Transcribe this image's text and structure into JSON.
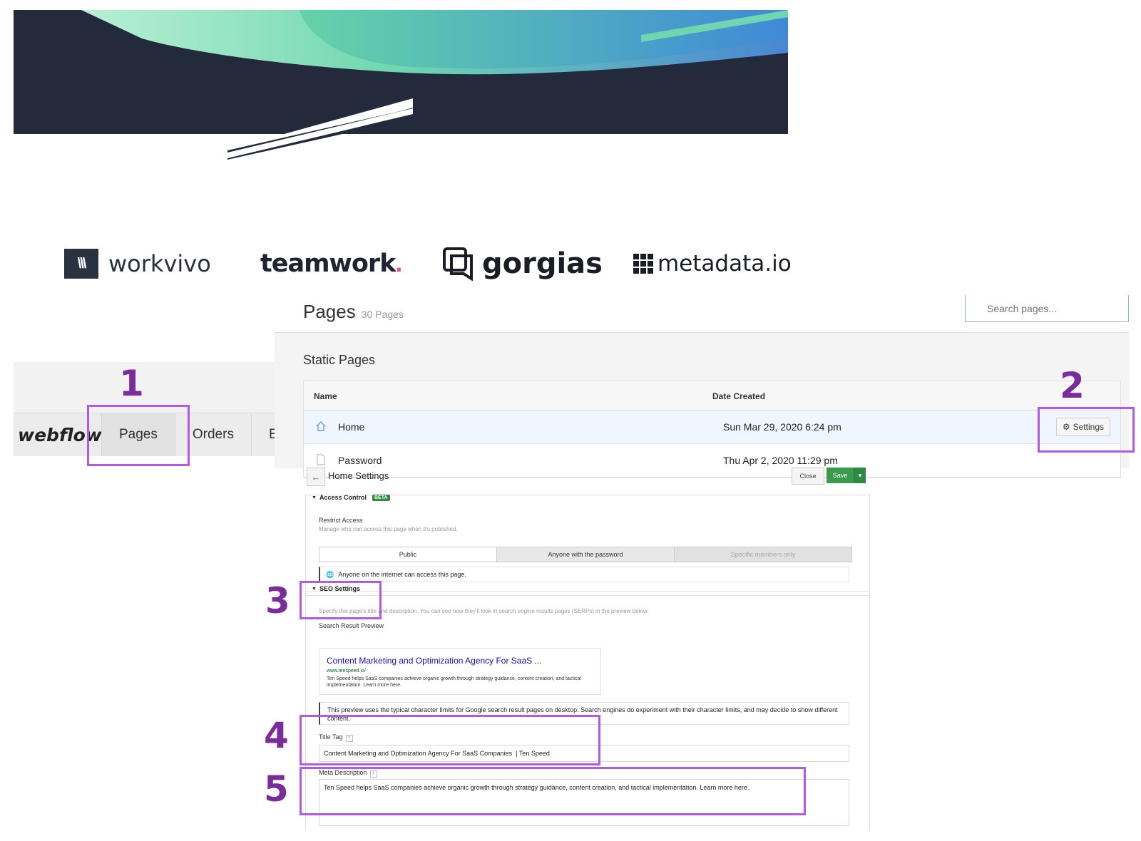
{
  "logos": {
    "workvivo": "workvivo",
    "teamwork": "teamwork",
    "teamwork_dot": ".",
    "gorgias": "gorgias",
    "metadata": "metadata.io"
  },
  "webflow_nav": {
    "logo": "webflow",
    "tabs": [
      "Pages",
      "Orders",
      "E"
    ],
    "active_tab": "Pages"
  },
  "pages": {
    "title": "Pages",
    "count": "30 Pages",
    "search_placeholder": "Search pages...",
    "section_title": "Static Pages",
    "columns": [
      "Name",
      "Date Created"
    ],
    "rows": [
      {
        "name": "Home",
        "date": "Sun Mar 29, 2020 6:24 pm"
      },
      {
        "name": "Password",
        "date": "Thu Apr 2, 2020 11:29 pm"
      }
    ],
    "settings_label": "Settings"
  },
  "home_settings": {
    "title": "Home Settings",
    "close_label": "Close",
    "save_label": "Save",
    "access_control": {
      "heading": "Access Control",
      "badge": "BETA",
      "restrict_label": "Restrict Access",
      "restrict_hint": "Manage who can access this page when it's published.",
      "options": [
        "Public",
        "Anyone with the password",
        "Specific members only"
      ],
      "selected": "Public",
      "note": "Anyone on the internet can access this page."
    },
    "seo": {
      "heading": "SEO Settings",
      "hint": "Specify this page's title and description. You can see how they'll look in search engine results pages (SERPs) in the preview below.",
      "preview_label": "Search Result Preview",
      "serp_title": "Content Marketing and Optimization Agency For SaaS ...",
      "serp_url": "www.tenspeed.io/",
      "serp_desc": "Ten Speed helps SaaS companies achieve organic growth through strategy guidance, content creation, and tactical implementation. Learn more here.",
      "preview_note": "This preview uses the typical character limits for Google search result pages on desktop. Search engines do experiment with their character limits, and may decide to show different content.",
      "title_tag_label": "Title Tag",
      "title_tag_value": "Content Marketing and Optimization Agency For SaaS Companies  | Ten Speed",
      "meta_label": "Meta Description",
      "meta_value": "Ten Speed helps SaaS companies achieve organic growth through strategy guidance, content creation, and tactical implementation. Learn more here."
    }
  },
  "annotations": [
    "1",
    "2",
    "3",
    "4",
    "5"
  ],
  "colors": {
    "annotation_box": "#b25ae6",
    "annotation_number": "#7b2c9b",
    "save_green": "#3a9b4e",
    "hero_dark": "#232a3c"
  }
}
